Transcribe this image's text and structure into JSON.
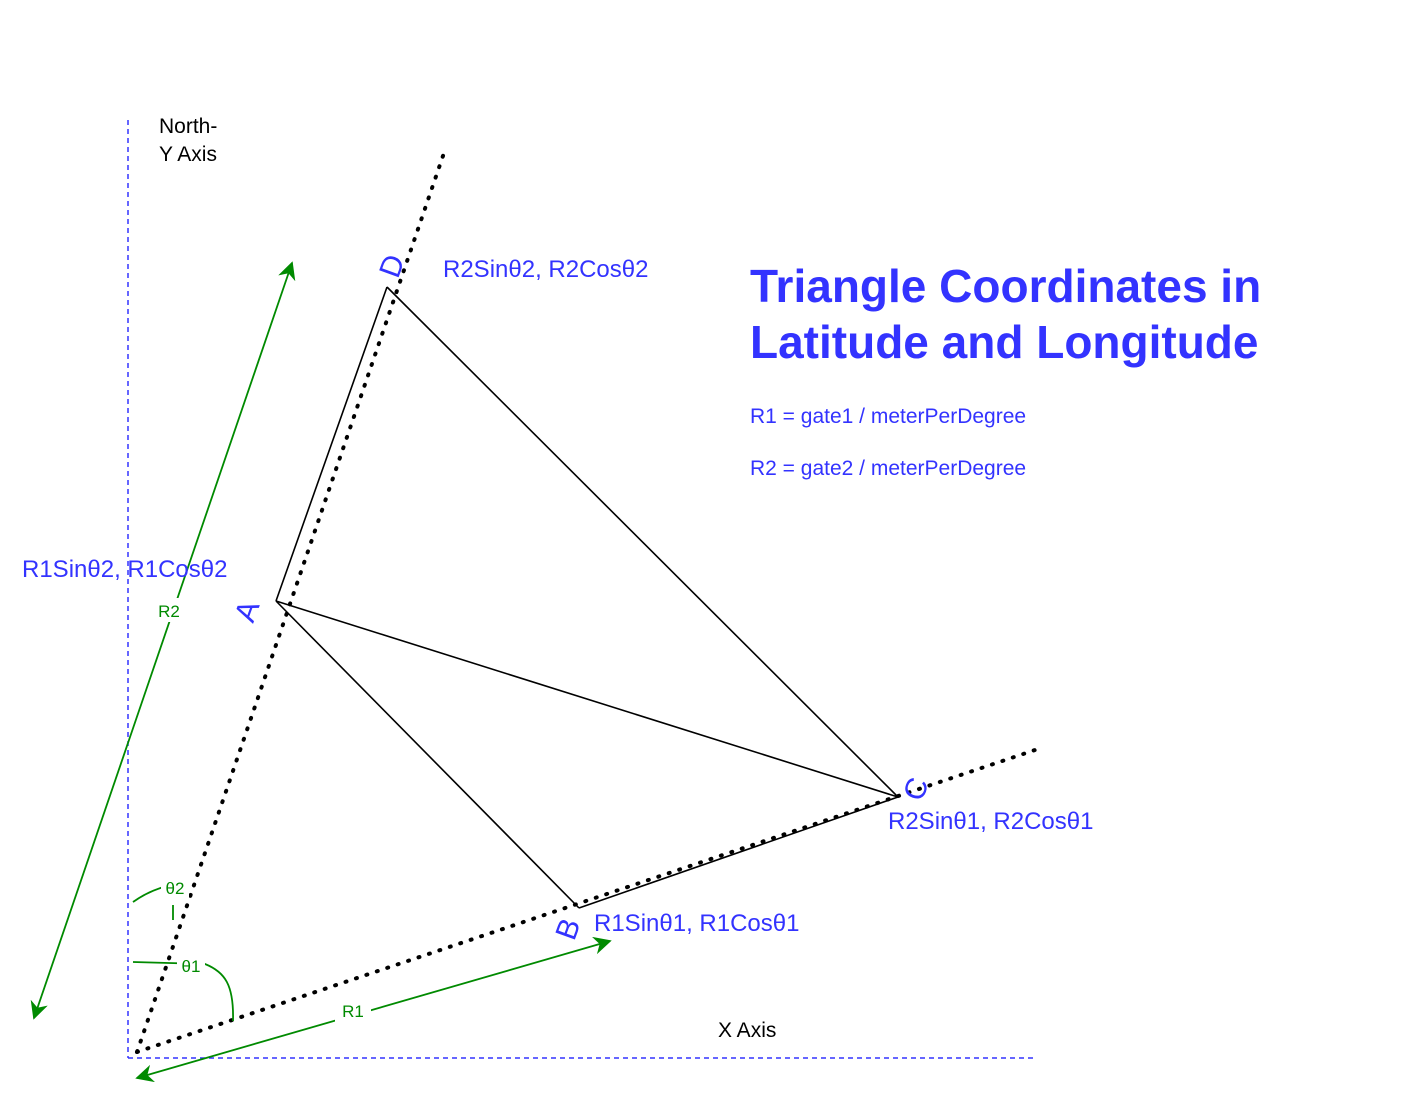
{
  "title": {
    "line1": "Triangle Coordinates in",
    "line2": "Latitude and Longitude"
  },
  "definitions": {
    "r1": "R1 = gate1 / meterPerDegree",
    "r2": "R2 = gate2 / meterPerDegree"
  },
  "axes": {
    "y_label_line1": "North-",
    "y_label_line2": "Y Axis",
    "x_label": "X Axis"
  },
  "points": {
    "a": {
      "letter": "A",
      "coords": "R1Sinθ2, R1Cosθ2"
    },
    "b": {
      "letter": "B",
      "coords": "R1Sinθ1, R1Cosθ1"
    },
    "c": {
      "letter": "C",
      "coords": "R2Sinθ1, R2Cosθ1"
    },
    "d": {
      "letter": "D",
      "coords": "R2Sinθ2, R2Cosθ2"
    }
  },
  "dimensions": {
    "r1": "R1",
    "r2": "R2",
    "theta1": "θ1",
    "theta2": "θ2"
  },
  "colors": {
    "axis": "#3333ff",
    "label": "#3333ff",
    "dimension": "#008a00",
    "edge": "#000000"
  }
}
